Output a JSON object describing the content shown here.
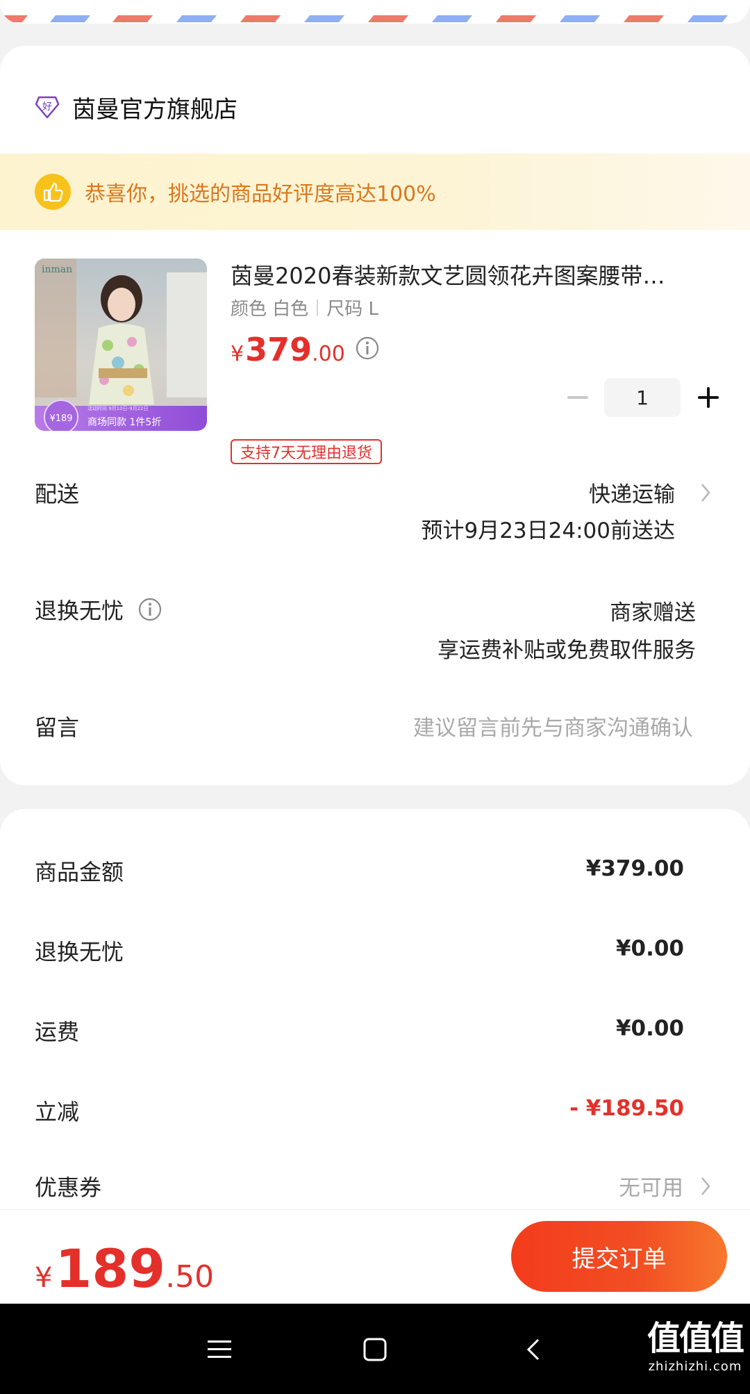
{
  "shop": {
    "name": "茵曼官方旗舰店",
    "icon": "good-badge-icon",
    "icon_glyph": "好"
  },
  "banner": {
    "text": "恭喜你，挑选的商品好评度高达100%",
    "icon": "thumbs-up-icon"
  },
  "product": {
    "image_logo": "inman",
    "image_badge_price": "¥189",
    "image_badge_text": "商场同款 1件5折",
    "image_badge_small": "活动时间 9月10日-9月22日",
    "title": "茵曼2020春装新款文艺圆领花卉图案腰带…",
    "spec_color": "颜色 白色",
    "spec_size": "尺码 L",
    "price_symbol": "¥",
    "price_int": "379",
    "price_dec": ".00",
    "quantity": "1",
    "return_tag": "支持7天无理由退货"
  },
  "delivery": {
    "label": "配送",
    "method": "快递运输",
    "eta": "预计9月23日24:00前送达"
  },
  "return_service": {
    "label": "退换无忧",
    "line1": "商家赠送",
    "line2": "享运费补贴或免费取件服务"
  },
  "message": {
    "label": "留言",
    "placeholder": "建议留言前先与商家沟通确认"
  },
  "summary": {
    "goods_label": "商品金额",
    "goods_value": "¥379.00",
    "return_label": "退换无忧",
    "return_value": "¥0.00",
    "shipping_label": "运费",
    "shipping_value": "¥0.00",
    "discount_label": "立减",
    "discount_value": "- ¥189.50",
    "coupon_label": "优惠券",
    "coupon_value": "无可用"
  },
  "bottom": {
    "total_symbol": "¥",
    "total_int": "189",
    "total_dec": ".50",
    "submit_label": "提交订单"
  },
  "watermark": {
    "main": "值值值",
    "sub": "zhizhizhi.com"
  },
  "colors": {
    "accent_red": "#e4302b",
    "banner_text": "#d8781e",
    "thumb_yellow": "#f8c21c",
    "shop_icon_purple": "#7b3fc0"
  }
}
